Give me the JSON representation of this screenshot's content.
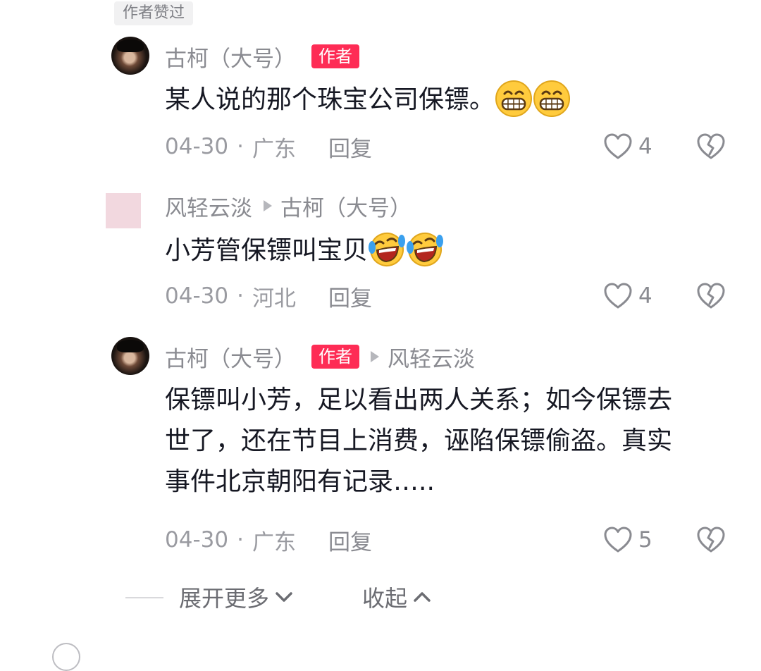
{
  "liked_tag": "作者赞过",
  "comments": [
    {
      "user": "古柯（大号）",
      "badge": "作者",
      "reply_to": "",
      "text": "某人说的那个珠宝公司保镖。",
      "emoji": "grin-emoji",
      "date": "04-30",
      "separator": "·",
      "location": "广东",
      "reply_label": "回复",
      "likes": "4"
    },
    {
      "user": "风轻云淡",
      "badge": "",
      "reply_to": "古柯（大号）",
      "text": "小芳管保镖叫宝贝",
      "emoji": "laugh-cry-emoji",
      "date": "04-30",
      "separator": "·",
      "location": "河北",
      "reply_label": "回复",
      "likes": "4"
    },
    {
      "user": "古柯（大号）",
      "badge": "作者",
      "reply_to": "风轻云淡",
      "text_lines": [
        "保镖叫小芳，足以看出两人关系；如今保镖去",
        "世了，还在节目上消费，诬陷保镖偷盗。真实",
        "事件北京朝阳有记录….."
      ],
      "date": "04-30",
      "separator": "·",
      "location": "广东",
      "reply_label": "回复",
      "likes": "5"
    }
  ],
  "controls": {
    "expand_label": "展开更多",
    "collapse_label": "收起"
  },
  "colors": {
    "badge": "#fe2c55",
    "muted_text": "#8a8b91",
    "primary_text": "#161823"
  }
}
